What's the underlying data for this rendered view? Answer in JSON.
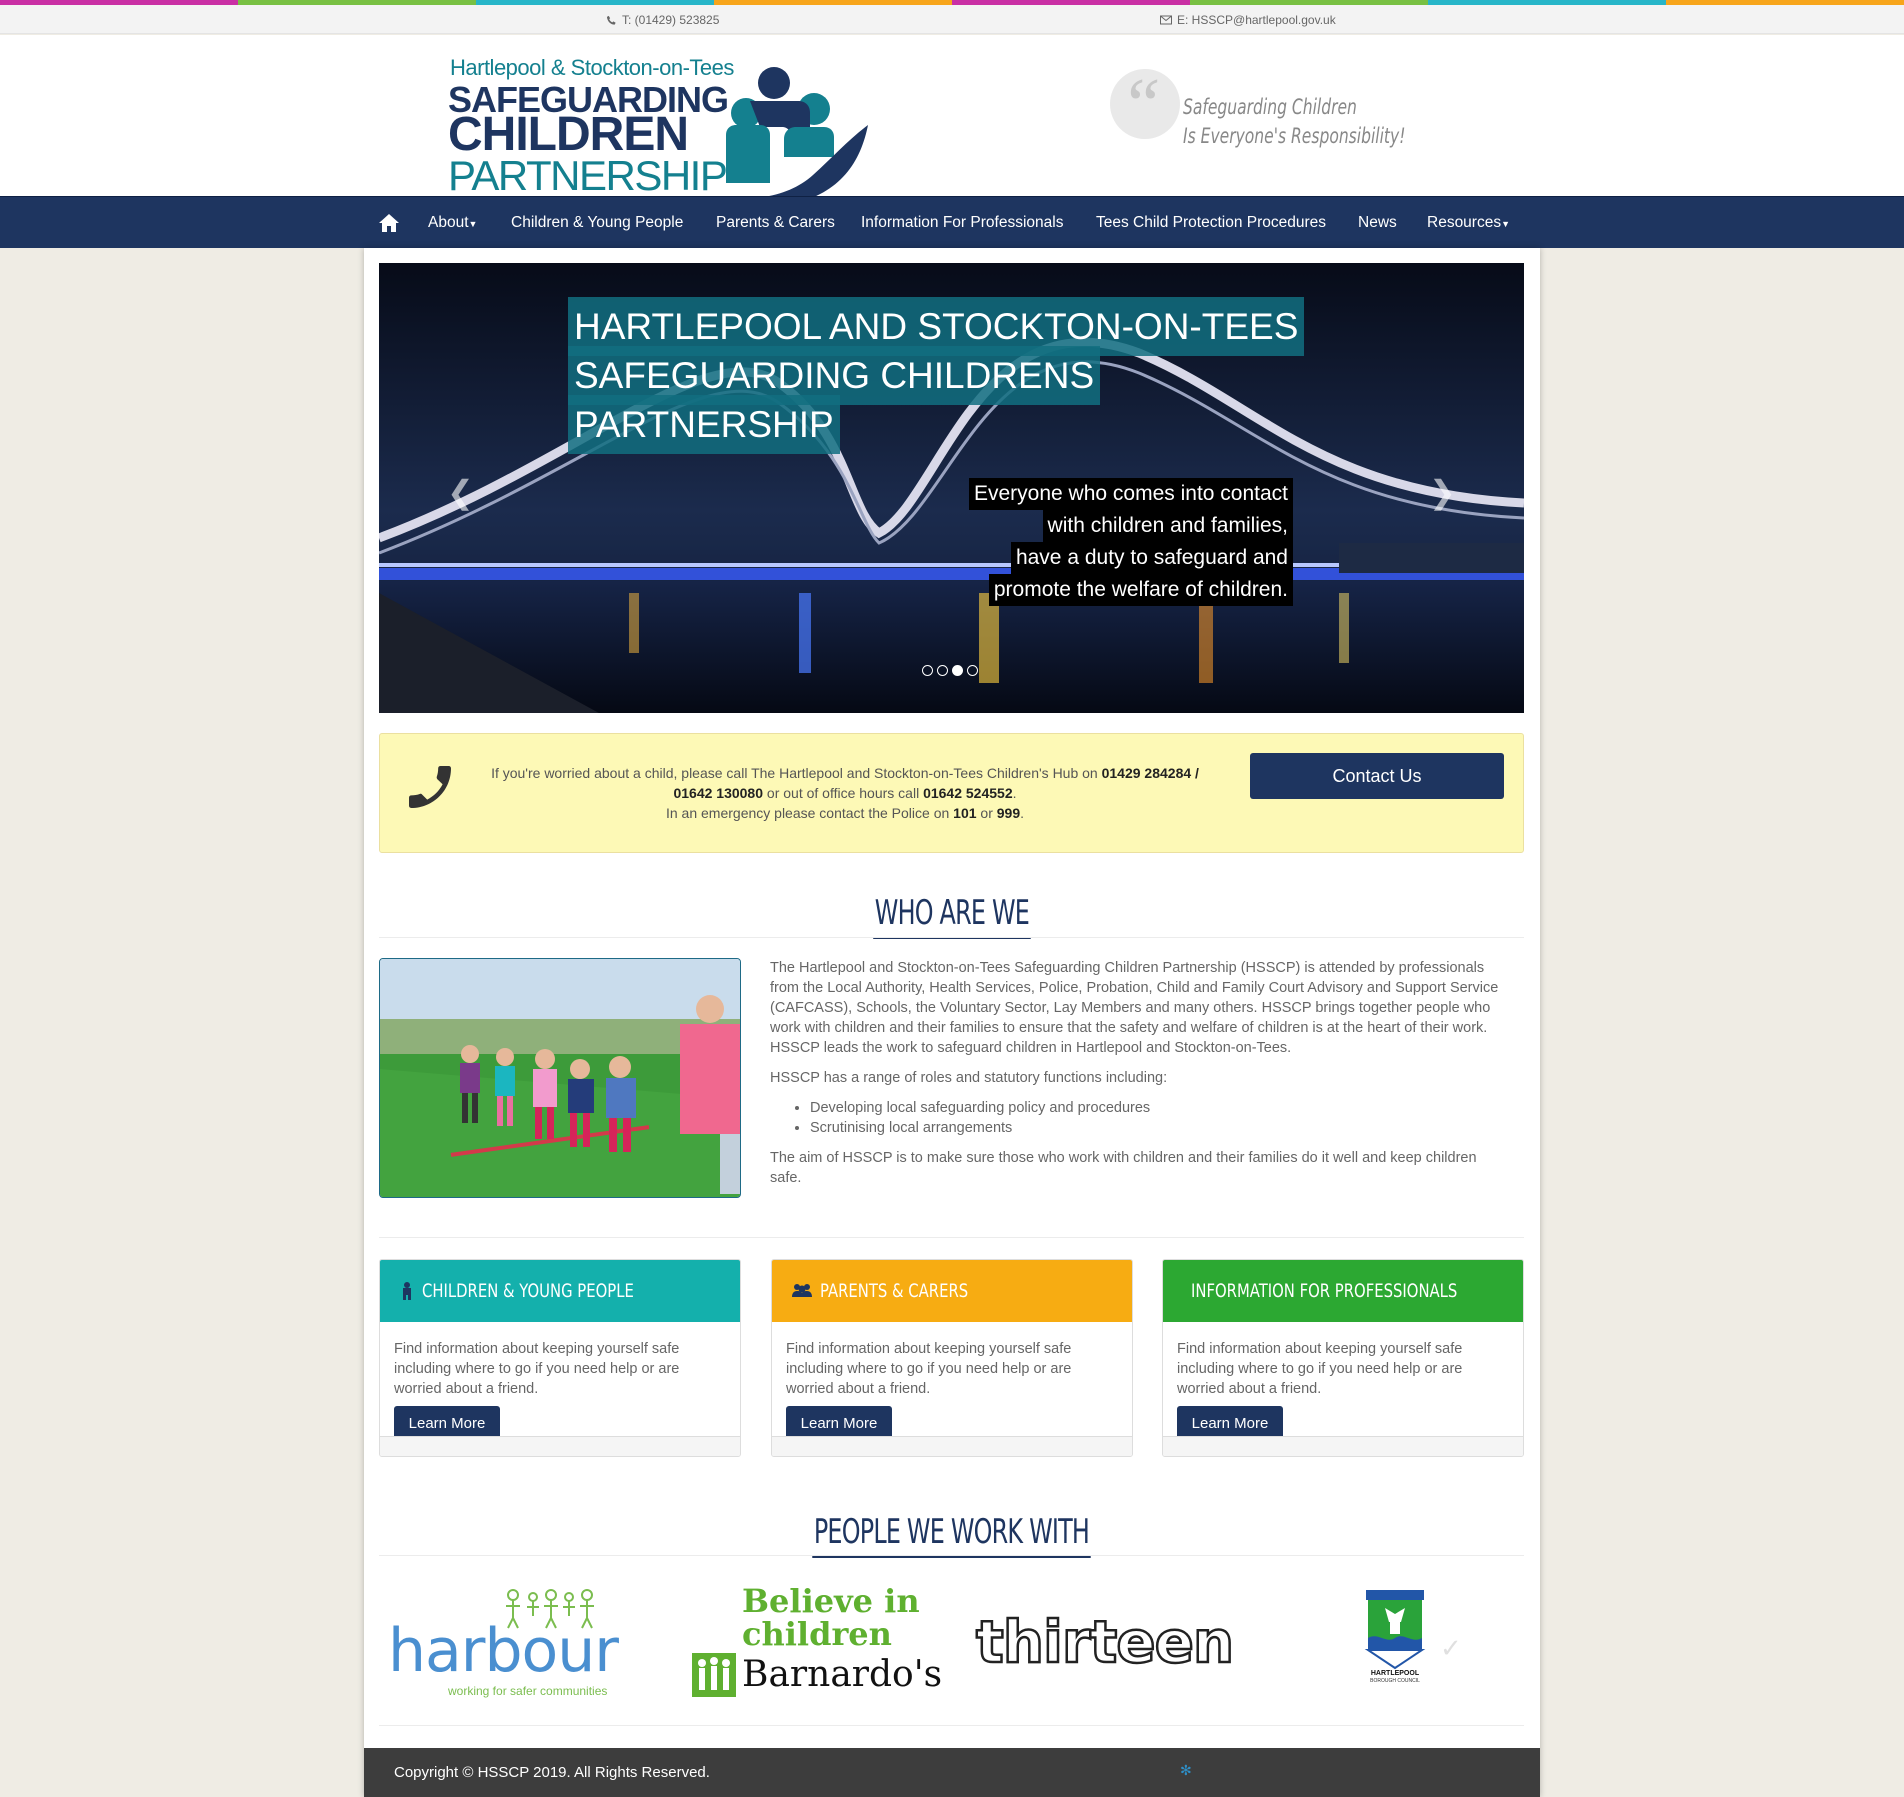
{
  "colors": {
    "navy": "#1e3560",
    "teal": "#14b0ac",
    "orange": "#f7ac12",
    "green": "#2ca832",
    "yellow_alert": "#fdf9b6",
    "stripe": [
      "#c92fa4",
      "#78c043",
      "#27b5c8",
      "#f7a51b",
      "#c92fa4",
      "#78c043",
      "#27b5c8",
      "#f7a51b"
    ]
  },
  "topbar": {
    "phone": "T: (01429) 523825",
    "email": "E: HSSCP@hartlepool.gov.uk"
  },
  "logo": {
    "line1": "Hartlepool & Stockton-on-Tees",
    "line2": "SAFEGUARDING",
    "line3": "CHILDREN",
    "line4": "PARTNERSHIP"
  },
  "tagline": {
    "line1": "Safeguarding Children",
    "line2": "Is Everyone's Responsibility!"
  },
  "nav": {
    "home_icon": "home-icon",
    "items": [
      "About",
      "Children & Young People",
      "Parents & Carers",
      "Information For Professionals",
      "Tees Child Protection Procedures",
      "News",
      "Resources"
    ]
  },
  "hero": {
    "title_lines": [
      "HARTLEPOOL AND STOCKTON-ON-TEES",
      "SAFEGUARDING CHILDRENS",
      "PARTNERSHIP"
    ],
    "sub_lines": [
      "Everyone who comes into contact",
      "with children and families,",
      "have a duty to safeguard and",
      "promote the welfare of children."
    ],
    "slide_count": 4,
    "active_slide": 3
  },
  "alert": {
    "t1": "If you're worried about a child, please call The Hartlepool and Stockton-on-Tees Children's Hub on ",
    "b1": "01429 284284 / 01642 130080",
    "t2": " or out of office hours call ",
    "b2": "01642 524552",
    "t3": ".",
    "t4": "In an emergency please contact the Police on ",
    "b3": "101",
    "t5": " or ",
    "b4": "999",
    "t6": ".",
    "contact_button": "Contact Us"
  },
  "who": {
    "title": "WHO ARE WE",
    "p1": "The Hartlepool and Stockton-on-Tees Safeguarding Children Partnership (HSSCP) is attended by professionals from the Local Authority, Health Services, Police, Probation, Child and Family Court Advisory and Support Service (CAFCASS), Schools, the Voluntary Sector, Lay Members and many others. HSSCP brings together people who work with children and their families to ensure that the safety and welfare of children is at the heart of their work. HSSCP leads the work to safeguard children in Hartlepool and Stockton-on-Tees.",
    "p2": "HSSCP has a range of roles and statutory functions including:",
    "list": [
      "Developing local safeguarding policy and procedures",
      "Scrutinising local arrangements"
    ],
    "p3": "The aim of HSSCP is to make sure those who work with children and their families do it well and keep children safe."
  },
  "panels": [
    {
      "title": "CHILDREN & YOUNG PEOPLE",
      "icon": "child-icon",
      "color": "#14b0ac",
      "text": "Find information about keeping yourself safe including where to go if you need help or are worried about a friend.",
      "button": "Learn More"
    },
    {
      "title": "PARENTS & CARERS",
      "icon": "users-icon",
      "color": "#f7ac12",
      "text": "Find information about keeping yourself safe including where to go if you need help or are worried about a friend.",
      "button": "Learn More"
    },
    {
      "title": "INFORMATION FOR PROFESSIONALS",
      "icon": "graduation-cap-icon",
      "color": "#2ca832",
      "text": "Find information about keeping yourself safe including where to go if you need help or are worried about a friend.",
      "button": "Learn More"
    }
  ],
  "partners": {
    "title": "PEOPLE WE WORK WITH",
    "harbour": {
      "name": "harbour",
      "tag": "working for safer communities"
    },
    "barnardos": {
      "l1": "Believe in",
      "l2": "children",
      "l3": "Barnardo's"
    },
    "thirteen": "thirteen",
    "hartlepool": {
      "l1": "HARTLEPOOL",
      "l2": "BOROUGH COUNCIL"
    }
  },
  "footer": {
    "copyright": "Copyright © HSSCP 2019. All Rights Reserved."
  }
}
